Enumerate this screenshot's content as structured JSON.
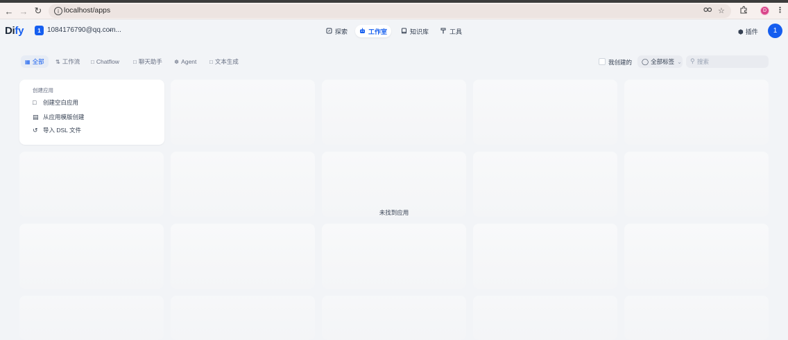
{
  "browser": {
    "url": "localhost/apps",
    "profile_initial": "D",
    "icons": [
      "back-icon",
      "forward-icon",
      "reload-icon",
      "site-info-icon",
      "password-key-icon",
      "bookmark-star-icon",
      "extensions-icon",
      "menu-dots-icon"
    ]
  },
  "header": {
    "logo_main": "Di",
    "logo_accent": "fy",
    "workspace_initial": "1",
    "workspace_name": "1084176790@qq.com...",
    "nav": [
      {
        "label": "探索",
        "icon": "compass-icon"
      },
      {
        "label": "工作室",
        "icon": "robot-icon"
      },
      {
        "label": "知识库",
        "icon": "book-icon"
      },
      {
        "label": "工具",
        "icon": "hammer-icon"
      }
    ],
    "active_nav": "工作室",
    "plugins_label": "插件",
    "user_initial": "1"
  },
  "filters": {
    "tabs": [
      {
        "label": "全部",
        "icon": "grid-icon"
      },
      {
        "label": "工作流",
        "icon": "workflow-icon"
      },
      {
        "label": "Chatflow",
        "icon": "chatflow-icon"
      },
      {
        "label": "聊天助手",
        "icon": "chat-icon"
      },
      {
        "label": "Agent",
        "icon": "agent-icon"
      },
      {
        "label": "文本生成",
        "icon": "doc-icon"
      }
    ],
    "active_tab": "全部",
    "mine_label": "我创建的",
    "mine_checked": false,
    "tag_label": "全部标签",
    "search_placeholder": "搜索"
  },
  "create_app": {
    "title": "创建应用",
    "items": [
      {
        "label": "创建空白应用",
        "icon": "new-file-icon"
      },
      {
        "label": "从应用模版创建",
        "icon": "template-icon"
      },
      {
        "label": "导入 DSL 文件",
        "icon": "import-icon"
      }
    ]
  },
  "empty_message": "未找到应用",
  "colors": {
    "accent": "#155eef",
    "page_bg": "#f2f4f7",
    "text": "#354052",
    "profile": "#d9468a"
  }
}
